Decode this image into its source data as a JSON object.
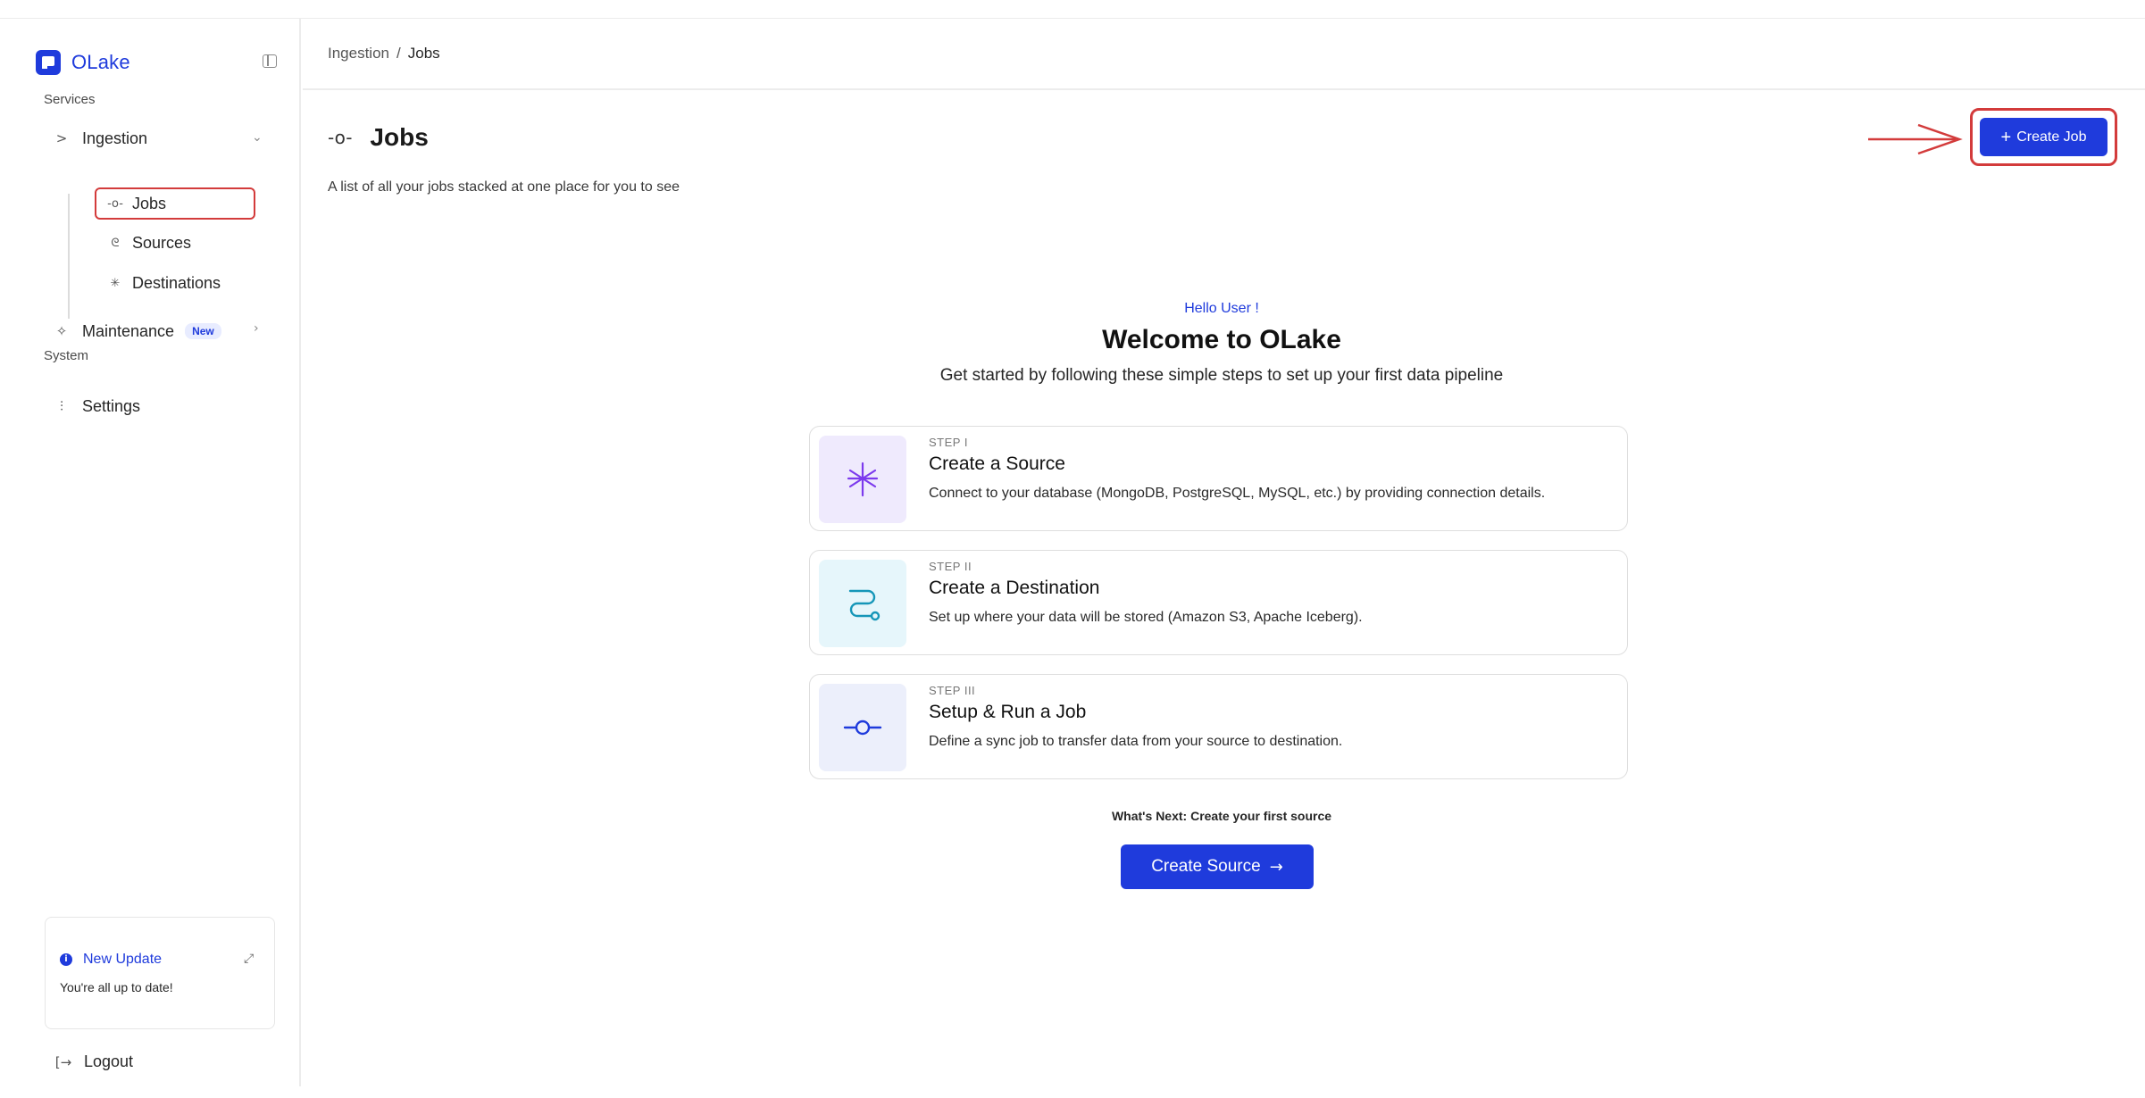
{
  "app": {
    "brand": "OLake"
  },
  "sidebar": {
    "services_label": "Services",
    "ingestion": {
      "label": "Ingestion",
      "icon": "ingestion-icon"
    },
    "sub_items": [
      {
        "label": "Jobs",
        "icon": "job-icon",
        "active": true
      },
      {
        "label": "Sources",
        "icon": "source-icon"
      },
      {
        "label": "Destinations",
        "icon": "destination-icon"
      }
    ],
    "maintenance": {
      "label": "Maintenance",
      "badge": "New",
      "icon": "maintenance-icon"
    },
    "system_label": "System",
    "settings": {
      "label": "Settings",
      "icon": "sliders-icon"
    },
    "update_card": {
      "title": "New Update",
      "text": "You're all up to date!"
    },
    "logout": "Logout"
  },
  "breadcrumb": {
    "parent": "Ingestion",
    "separator": "/",
    "current": "Jobs"
  },
  "page": {
    "title": "Jobs",
    "subtitle": "A list of all your jobs stacked at one place for you to see",
    "create_job_label": "Create Job"
  },
  "welcome": {
    "greeting": "Hello User !",
    "title": "Welcome to OLake",
    "description": "Get started by following these simple steps to set up your first data pipeline",
    "steps": [
      {
        "label": "STEP I",
        "title": "Create a Source",
        "desc": "Connect to your database (MongoDB, PostgreSQL, MySQL, etc.) by providing connection details.",
        "icon": "spark-icon",
        "color": "#7c3aed",
        "bg": "#efeafd"
      },
      {
        "label": "STEP II",
        "title": "Create a Destination",
        "desc": "Set up where your data will be stored (Amazon S3, Apache Iceberg).",
        "icon": "route-icon",
        "color": "#1596b8",
        "bg": "#e6f6fb"
      },
      {
        "label": "STEP III",
        "title": "Setup & Run a Job",
        "desc": "Define a sync job to transfer data from your source to destination.",
        "icon": "commit-icon",
        "color": "#1f3bdc",
        "bg": "#eceffb"
      }
    ],
    "next_text": "What's Next: Create your first source",
    "cta_label": "Create Source"
  },
  "colors": {
    "accent": "#1f3bdc",
    "annotation": "#d33b3b"
  }
}
